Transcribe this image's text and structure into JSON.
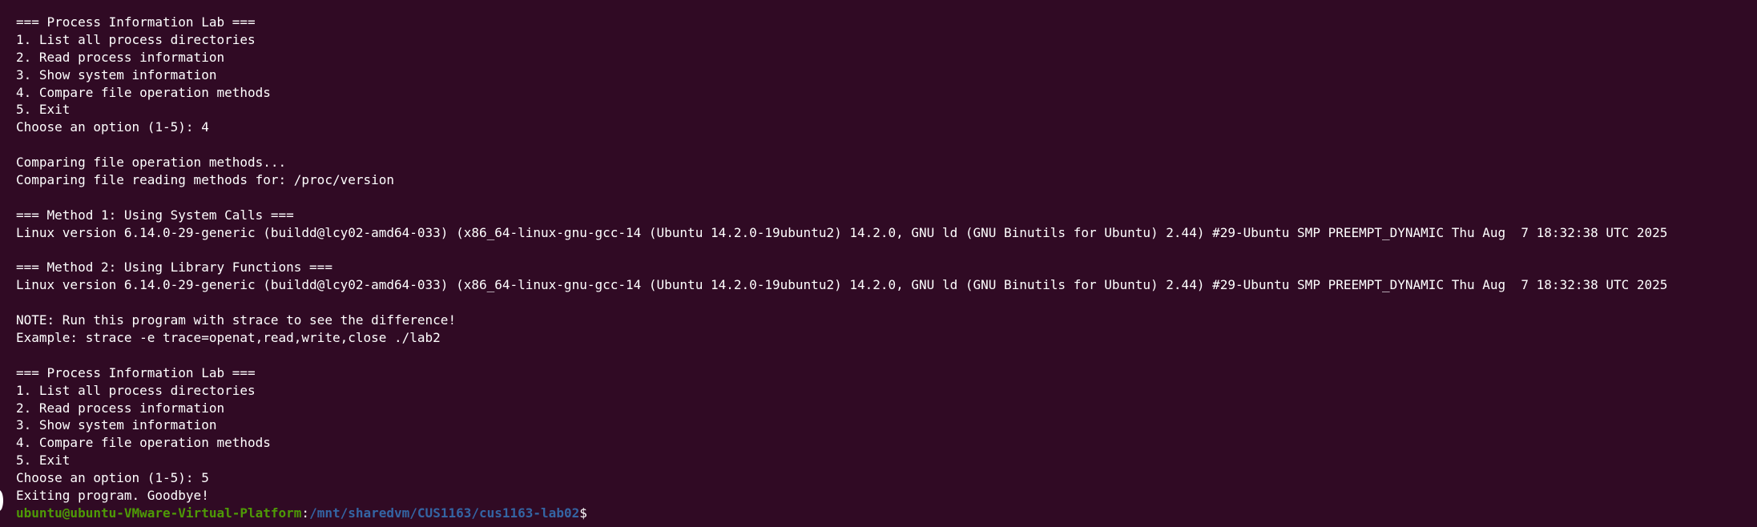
{
  "terminal": {
    "lines": [
      "=== Process Information Lab ===",
      "1. List all process directories",
      "2. Read process information",
      "3. Show system information",
      "4. Compare file operation methods",
      "5. Exit",
      "Choose an option (1-5): 4",
      "",
      "Comparing file operation methods...",
      "Comparing file reading methods for: /proc/version",
      "",
      "=== Method 1: Using System Calls ===",
      "Linux version 6.14.0-29-generic (buildd@lcy02-amd64-033) (x86_64-linux-gnu-gcc-14 (Ubuntu 14.2.0-19ubuntu2) 14.2.0, GNU ld (GNU Binutils for Ubuntu) 2.44) #29-Ubuntu SMP PREEMPT_DYNAMIC Thu Aug  7 18:32:38 UTC 2025",
      "",
      "=== Method 2: Using Library Functions ===",
      "Linux version 6.14.0-29-generic (buildd@lcy02-amd64-033) (x86_64-linux-gnu-gcc-14 (Ubuntu 14.2.0-19ubuntu2) 14.2.0, GNU ld (GNU Binutils for Ubuntu) 2.44) #29-Ubuntu SMP PREEMPT_DYNAMIC Thu Aug  7 18:32:38 UTC 2025",
      "",
      "NOTE: Run this program with strace to see the difference!",
      "Example: strace -e trace=openat,read,write,close ./lab2",
      "",
      "=== Process Information Lab ===",
      "1. List all process directories",
      "2. Read process information",
      "3. Show system information",
      "4. Compare file operation methods",
      "5. Exit",
      "Choose an option (1-5): 5",
      "Exiting program. Goodbye!"
    ],
    "prompt": {
      "user_host": "ubuntu@ubuntu-VMware-Virtual-Platform",
      "colon": ":",
      "path": "/mnt/sharedvm/CUS1163/cus1163-lab02",
      "symbol": "$"
    },
    "colors": {
      "background": "#300a24",
      "text": "#ffffff",
      "prompt_user": "#4e9a06",
      "prompt_path": "#3465a4"
    }
  }
}
